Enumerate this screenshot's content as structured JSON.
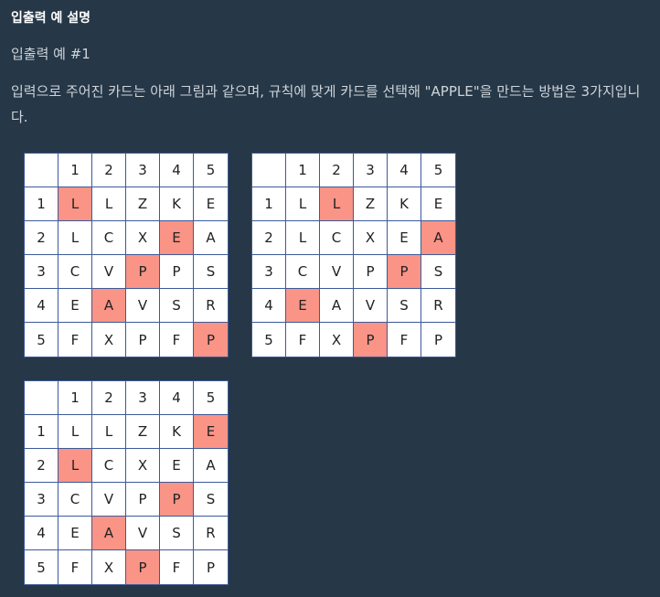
{
  "heading": "입출력 예 설명",
  "subheading": "입출력 예 #1",
  "description": "입력으로 주어진 카드는 아래 그림과 같으며, 규칙에 맞게 카드를 선택해 \"APPLE\"을 만드는 방법은 3가지입니다.",
  "colors": {
    "background": "#263747",
    "highlight": "#fa9486",
    "grid_border": "#3d5a99"
  },
  "grids": [
    {
      "header": [
        "",
        "1",
        "2",
        "3",
        "4",
        "5"
      ],
      "rows": [
        {
          "label": "1",
          "cells": [
            "L",
            "L",
            "Z",
            "K",
            "E"
          ]
        },
        {
          "label": "2",
          "cells": [
            "L",
            "C",
            "X",
            "E",
            "A"
          ]
        },
        {
          "label": "3",
          "cells": [
            "C",
            "V",
            "P",
            "P",
            "S"
          ]
        },
        {
          "label": "4",
          "cells": [
            "E",
            "A",
            "V",
            "S",
            "R"
          ]
        },
        {
          "label": "5",
          "cells": [
            "F",
            "X",
            "P",
            "F",
            "P"
          ]
        }
      ],
      "highlighted": [
        [
          1,
          1
        ],
        [
          2,
          4
        ],
        [
          3,
          3
        ],
        [
          4,
          2
        ],
        [
          5,
          5
        ]
      ]
    },
    {
      "header": [
        "",
        "1",
        "2",
        "3",
        "4",
        "5"
      ],
      "rows": [
        {
          "label": "1",
          "cells": [
            "L",
            "L",
            "Z",
            "K",
            "E"
          ]
        },
        {
          "label": "2",
          "cells": [
            "L",
            "C",
            "X",
            "E",
            "A"
          ]
        },
        {
          "label": "3",
          "cells": [
            "C",
            "V",
            "P",
            "P",
            "S"
          ]
        },
        {
          "label": "4",
          "cells": [
            "E",
            "A",
            "V",
            "S",
            "R"
          ]
        },
        {
          "label": "5",
          "cells": [
            "F",
            "X",
            "P",
            "F",
            "P"
          ]
        }
      ],
      "highlighted": [
        [
          1,
          2
        ],
        [
          2,
          5
        ],
        [
          3,
          4
        ],
        [
          4,
          1
        ],
        [
          5,
          3
        ]
      ]
    },
    {
      "header": [
        "",
        "1",
        "2",
        "3",
        "4",
        "5"
      ],
      "rows": [
        {
          "label": "1",
          "cells": [
            "L",
            "L",
            "Z",
            "K",
            "E"
          ]
        },
        {
          "label": "2",
          "cells": [
            "L",
            "C",
            "X",
            "E",
            "A"
          ]
        },
        {
          "label": "3",
          "cells": [
            "C",
            "V",
            "P",
            "P",
            "S"
          ]
        },
        {
          "label": "4",
          "cells": [
            "E",
            "A",
            "V",
            "S",
            "R"
          ]
        },
        {
          "label": "5",
          "cells": [
            "F",
            "X",
            "P",
            "F",
            "P"
          ]
        }
      ],
      "highlighted": [
        [
          1,
          5
        ],
        [
          2,
          1
        ],
        [
          3,
          4
        ],
        [
          4,
          2
        ],
        [
          5,
          3
        ]
      ]
    }
  ]
}
